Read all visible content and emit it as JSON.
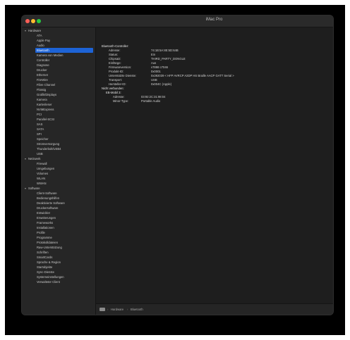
{
  "window": {
    "title": "iMac Pro"
  },
  "sidebar": {
    "sections": [
      {
        "label": "Hardware",
        "items": [
          "ATA",
          "Apple Pay",
          "Audio",
          "Bluetooth",
          "Kamera von Medien",
          "Controller",
          "Diagnose",
          "Drucker",
          "Ethernet",
          "FireWire",
          "Fibre Channel",
          "Flüssig",
          "Grafik/Displays",
          "Kamera",
          "Kartenleser",
          "NVMExpress",
          "PCI",
          "Parallel-SCSI",
          "SAS",
          "SATA",
          "SPI",
          "Speicher",
          "Stromversorgung",
          "Thunderbolt/USB4",
          "USB"
        ]
      },
      {
        "label": "Netzwerk",
        "items": [
          "Firewall",
          "Umgebungen",
          "Volumes",
          "WLAN",
          "WWAN"
        ]
      },
      {
        "label": "Software",
        "items": [
          "Client-Software",
          "Bedienungshilfen",
          "Deaktivierte Software",
          "Druckersoftware",
          "Entwickler",
          "Erweiterungen",
          "Frameworks",
          "Installationen",
          "Profile",
          "Programme",
          "Protokolldateien",
          "Raw-Unterstützung",
          "Schriften",
          "SmartCards",
          "Sprache & Region",
          "Startobjekte",
          "Sync-Dienste",
          "Systemeinstellungen",
          "Verwalteter Client"
        ]
      }
    ],
    "selected": "Bluetooth"
  },
  "content": {
    "section_title": "Bluetooth-Controller:",
    "controller_rows": [
      {
        "key": "Adresse:",
        "value": "74:1B:5A:8E:5D:64B"
      },
      {
        "key": "Status:",
        "value": "Ein"
      },
      {
        "key": "Chipsatz:",
        "value": "THIRD_PARTY_DONGLE"
      },
      {
        "key": "Einfänge:",
        "value": "Aus"
      },
      {
        "key": "Firmwareversion:",
        "value": "v7898 c7046"
      },
      {
        "key": "Produkt-ID:",
        "value": "0x0001"
      },
      {
        "key": "Unterstützte Dienste:",
        "value": "0x392039 < HFP AVRCP A2DP HS Braille AACP GATT Serial >"
      },
      {
        "key": "Transport:",
        "value": "USB"
      },
      {
        "key": "Hersteller-ID:",
        "value": "0x004C (Apple)"
      }
    ],
    "devices_label": "Nicht verbunden:",
    "device_name": "EB-Mobil 3:",
    "device_rows": [
      {
        "key": "Adresse:",
        "value": "03:92:2C:31:98:04"
      },
      {
        "key": "Minor-Type:",
        "value": "Portable Audio"
      }
    ]
  },
  "statusbar": {
    "crumbs": [
      "Hardware",
      "Bluetooth"
    ],
    "separator": "›"
  }
}
